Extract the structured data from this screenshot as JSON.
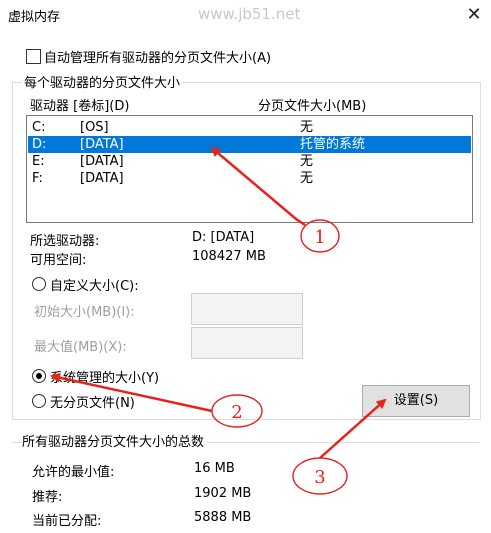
{
  "window": {
    "title": "虚拟内存",
    "watermark": "www.jb51.net"
  },
  "auto_manage": {
    "label": "自动管理所有驱动器的分页文件大小(A)",
    "checked": false
  },
  "per_drive": {
    "group_title": "每个驱动器的分页文件大小",
    "col_drive": "驱动器 [卷标](D)",
    "col_size": "分页文件大小(MB)",
    "rows": [
      {
        "drive": "C:",
        "label": "[OS]",
        "size": "无",
        "selected": false
      },
      {
        "drive": "D:",
        "label": "[DATA]",
        "size": "托管的系统",
        "selected": true
      },
      {
        "drive": "E:",
        "label": "[DATA]",
        "size": "无",
        "selected": false
      },
      {
        "drive": "F:",
        "label": "[DATA]",
        "size": "无",
        "selected": false
      }
    ],
    "selected_drive_label": "所选驱动器:",
    "selected_drive_value": "D:  [DATA]",
    "free_space_label": "可用空间:",
    "free_space_value": "108427 MB",
    "custom_size_label": "自定义大小(C):",
    "initial_size_label": "初始大小(MB)(I):",
    "max_size_label": "最大值(MB)(X):",
    "system_managed_label": "系统管理的大小(Y)",
    "no_paging_label": "无分页文件(N)",
    "selected_option": "system_managed",
    "set_button": "设置(S)"
  },
  "totals": {
    "group_title": "所有驱动器分页文件大小的总数",
    "min_label": "允许的最小值:",
    "min_value": "16 MB",
    "recommended_label": "推荐:",
    "recommended_value": "1902 MB",
    "current_label": "当前已分配:",
    "current_value": "5888 MB"
  },
  "annotations": {
    "marker1": "1",
    "marker2": "2",
    "marker3": "3",
    "color": "#e8221b"
  }
}
